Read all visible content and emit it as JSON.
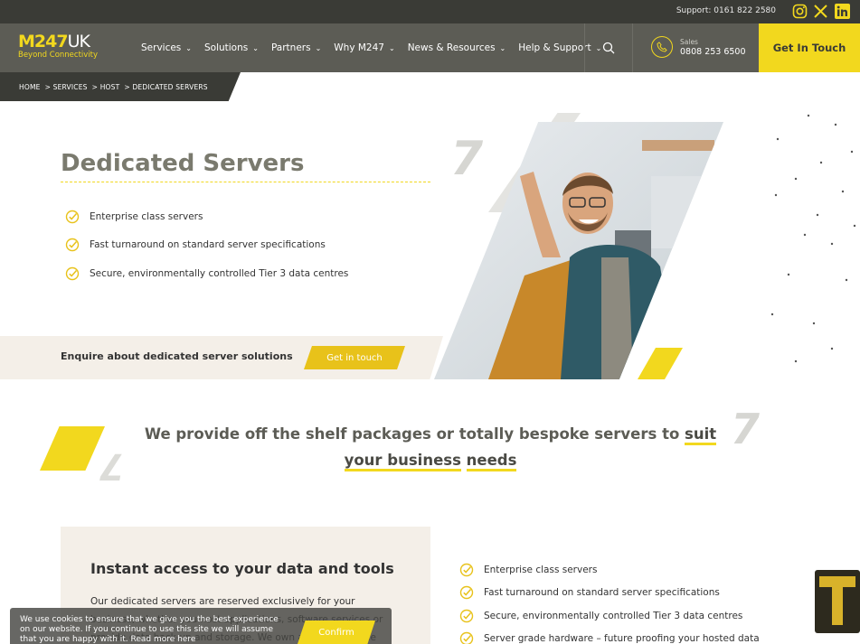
{
  "topbar": {
    "support": "Support: 0161 822 2580",
    "social_icons": [
      "instagram-icon",
      "x-icon",
      "linkedin-icon"
    ]
  },
  "header": {
    "logo": {
      "mark": "M247",
      "uk": "UK",
      "tagline": "Beyond Connectivity"
    },
    "nav": [
      {
        "label": "Services"
      },
      {
        "label": "Solutions"
      },
      {
        "label": "Partners"
      },
      {
        "label": "Why M247"
      },
      {
        "label": "News & Resources"
      },
      {
        "label": "Help & Support"
      }
    ],
    "sales_label": "Sales",
    "sales_number": "0808 253 6500",
    "cta": "Get In Touch"
  },
  "breadcrumb": [
    "HOME",
    "> SERVICES",
    "> HOST",
    "> DEDICATED SERVERS"
  ],
  "hero": {
    "title": "Dedicated Servers",
    "features": [
      "Enterprise class servers",
      "Fast turnaround on standard server specifications",
      "Secure, environmentally controlled Tier 3 data centres"
    ],
    "enquire_text": "Enquire about dedicated server solutions",
    "enquire_button": "Get in touch",
    "deco_numeral": "7"
  },
  "tagline": {
    "before": "We provide off the shelf packages or totally bespoke servers to ",
    "highlight_1": "suit your business",
    "highlight_2": "needs",
    "deco_numeral": "7"
  },
  "info": {
    "title": "Instant access to your data and tools",
    "body": "Our dedicated servers are reserved exclusively for your business, whether you host applications, software services or provide data back-up and storage. We own and manage the hardware on your",
    "features": [
      "Enterprise class servers",
      "Fast turnaround on standard server specifications",
      "Secure, environmentally controlled Tier 3 data centres",
      "Server grade hardware – future proofing your hosted data"
    ]
  },
  "cookie": {
    "text": "We use cookies to ensure that we give you the best experience on our website. If you continue to use this site we will assume that you are happy with it. Read more here",
    "button": "Confirm"
  },
  "colors": {
    "brand_yellow": "#f2d81e",
    "dark": "#3a3b36",
    "header": "#5c5c55",
    "beige": "#f4efe8"
  }
}
